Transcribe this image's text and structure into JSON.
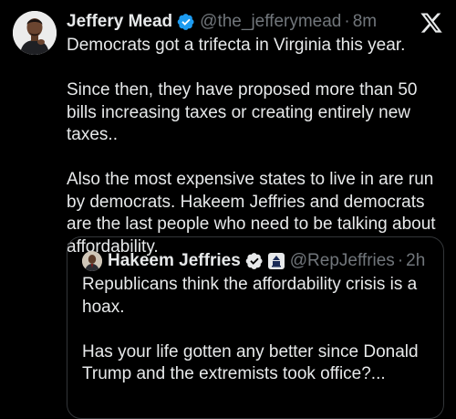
{
  "post": {
    "author_name": "Jeffery Mead",
    "author_handle": "@the_jefferymead",
    "separator": "·",
    "time": "8m",
    "verified_icon": "verified-badge-icon",
    "paragraphs": [
      "Democrats got a trifecta in Virginia this year.",
      "Since then, they have proposed more than 50 bills increasing taxes or creating entirely new taxes..",
      "Also the most expensive states to live in are run by democrats. Hakeem Jeffries and democrats are the last people who need to be talking about affordability."
    ]
  },
  "quote": {
    "author_name": "Hakeem Jeffries",
    "author_handle": "@RepJeffries",
    "separator": "·",
    "time": "2h",
    "verified_icon": "verified-badge-icon",
    "affiliation_icon": "capitol-badge-icon",
    "paragraphs": [
      "Republicans think the affordability crisis is a hoax.",
      "Has your life gotten any better since Donald Trump and the extremists took office?..."
    ]
  },
  "colors": {
    "background": "#000000",
    "text": "#e7e9ea",
    "secondary_text": "#71767b",
    "verified_blue": "#1d9bf0",
    "border": "#333639"
  },
  "icons": {
    "logo": "x-logo-icon"
  }
}
